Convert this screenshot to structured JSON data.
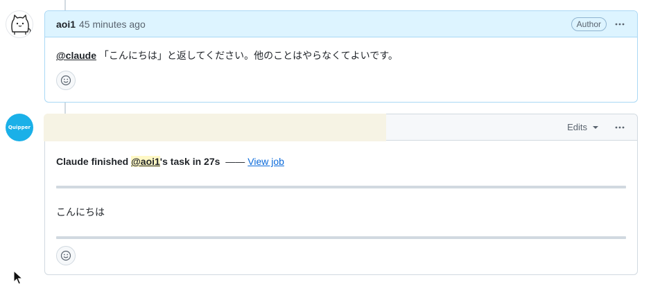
{
  "comment1": {
    "author": "aoi1",
    "time": "45 minutes ago",
    "badge": "Author",
    "mention": "@claude",
    "body": "「こんにちは」と返してください。他のことはやらなくてよいです。"
  },
  "comment2": {
    "avatar_text": "Quipper",
    "edits_label": "Edits",
    "status_prefix": "Claude finished",
    "status_mention": "@aoi1",
    "status_suffix": "'s task in 27s",
    "dash": "——",
    "link_text": "View job",
    "reply": "こんにちは"
  },
  "colors": {
    "header_bg_author": "#ddf4ff",
    "link": "#0969da",
    "org_avatar": "#1ab0e8"
  },
  "icons": [
    "cat-avatar-icon",
    "kebab-icon",
    "smiley-icon",
    "caret-down-icon",
    "mouse-pointer-icon"
  ]
}
